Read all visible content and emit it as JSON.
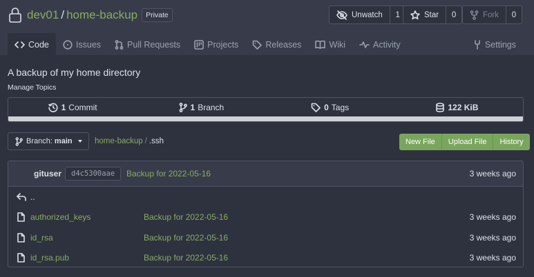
{
  "repo": {
    "owner": "dev01",
    "separator": "/",
    "name": "home-backup",
    "visibility": "Private",
    "description": "A backup of my home directory",
    "manage_topics": "Manage Topics"
  },
  "actions": {
    "watch": {
      "label": "Unwatch",
      "count": "1",
      "icon": "eye-slash-icon"
    },
    "star": {
      "label": "Star",
      "count": "0",
      "icon": "star-icon"
    },
    "fork": {
      "label": "Fork",
      "count": "0",
      "icon": "fork-icon"
    }
  },
  "tabs": [
    {
      "label": "Code",
      "icon": "code-icon",
      "active": true
    },
    {
      "label": "Issues",
      "icon": "issue-icon"
    },
    {
      "label": "Pull Requests",
      "icon": "pull-request-icon"
    },
    {
      "label": "Projects",
      "icon": "project-icon"
    },
    {
      "label": "Releases",
      "icon": "tag-icon"
    },
    {
      "label": "Wiki",
      "icon": "book-icon"
    },
    {
      "label": "Activity",
      "icon": "pulse-icon"
    }
  ],
  "settings_tab": {
    "label": "Settings",
    "icon": "tools-icon"
  },
  "stats": {
    "commits": {
      "count": "1",
      "label": "Commit"
    },
    "branches": {
      "count": "1",
      "label": "Branch"
    },
    "tags": {
      "count": "0",
      "label": "Tags"
    },
    "size": {
      "count": "122 KiB"
    }
  },
  "language_bar_color": "#cfd1d6",
  "branch": {
    "prefix": "Branch:",
    "name": "main"
  },
  "path": {
    "root": "home-backup",
    "separator": "/",
    "current": ".ssh"
  },
  "file_actions": [
    "New File",
    "Upload File",
    "History"
  ],
  "latest_commit": {
    "author": "gituser",
    "sha": "d4c5300aae",
    "message": "Backup for 2022-05-16",
    "age": "3 weeks ago"
  },
  "parent_dir": "..",
  "files": [
    {
      "name": "authorized_keys",
      "message": "Backup for 2022-05-16",
      "age": "3 weeks ago"
    },
    {
      "name": "id_rsa",
      "message": "Backup for 2022-05-16",
      "age": "3 weeks ago"
    },
    {
      "name": "id_rsa.pub",
      "message": "Backup for 2022-05-16",
      "age": "3 weeks ago"
    }
  ],
  "colors": {
    "link_green": "#87ab63",
    "button_green": "#79a65d",
    "background": "#2e323e",
    "header": "#383c4a"
  }
}
